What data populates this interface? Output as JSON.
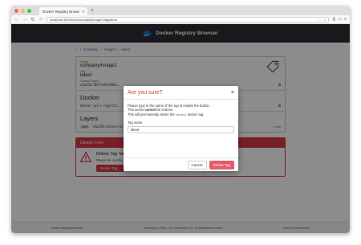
{
  "browser": {
    "tab_title": "Docker Registry Browser",
    "tab_close": "×",
    "new_tab": "+",
    "url": "localhost:3000/repo/company/image1/tag/latest",
    "nav": {
      "back": "←",
      "forward": "→",
      "reload": "↻",
      "home": "⌂"
    },
    "url_icons": {
      "menu": "···",
      "star": "☆",
      "library": "|||",
      "sidebar": "▭",
      "menu2": "≡"
    }
  },
  "app": {
    "brand": "Docker Registry Browser"
  },
  "breadcrumb": {
    "home_icon": "⌂",
    "items": [
      "company",
      "image1",
      "latest"
    ],
    "separator": "/"
  },
  "tag_card": {
    "image_label": "Image",
    "image_value": "company/image1",
    "tag_label": "Tag",
    "tag_value": "latest",
    "digest_label": "Content Digest",
    "digest_value": "sha256:8073c923e88e…",
    "copy_icon": "⧉"
  },
  "docker_card": {
    "title": "Docker",
    "command": "docker pull registr…"
  },
  "layers_card": {
    "title": "Layers",
    "badge": "2MB",
    "layer_digest": "sha256:docker/se…",
    "time": "1 min"
  },
  "danger": {
    "header": "Danger Zone",
    "title": "Delete Tag 'latest'",
    "description": "Please be careful. You can NOT undo this.",
    "button": "Delete Tag..."
  },
  "footer": {
    "left": "Docker Registry Browser",
    "center": "Running on Ruby 2.5.1 and Rails 5.2.1 in development mode",
    "right": "Icons by icons8.com"
  },
  "modal": {
    "title": "Are you sure?",
    "close": "×",
    "line1": "Please type in the name of the tag to enable the button.",
    "line2_pre": "This action ",
    "line2_bold": "cannot",
    "line2_post": " be undone.",
    "line3_pre": "This will permanently delete the ",
    "line3_code": "latest",
    "line3_post": " docker tag.",
    "field_label": "Tag name",
    "field_value": "latest",
    "cancel": "Cancel",
    "delete": "Delete Tag"
  },
  "colors": {
    "danger": "#dc3545",
    "header_bg": "#2c2f33",
    "link": "#2a6db5"
  }
}
